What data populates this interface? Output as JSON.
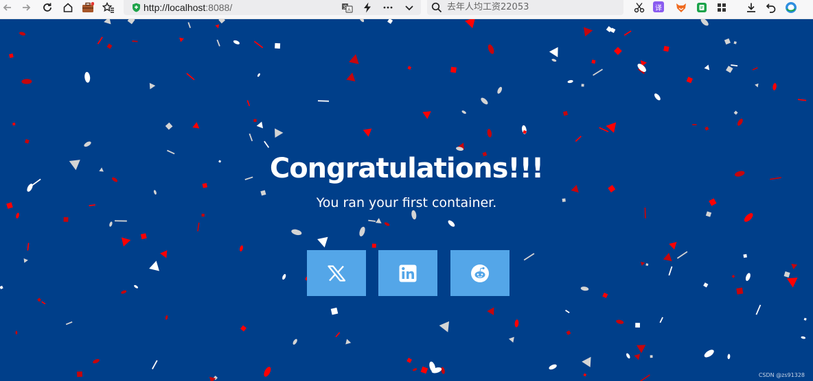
{
  "browser": {
    "url_host": "http://localhost",
    "url_port": ":8088/",
    "search_placeholder": "去年人均工资22053",
    "extensions": [
      {
        "icon": "translate-extension-icon",
        "label": "译",
        "color": "#8a5cf0"
      },
      {
        "icon": "fox-extension-icon",
        "label": "",
        "color": "#ef6b21"
      },
      {
        "icon": "green-extension-icon",
        "label": "",
        "color": "#1aa34a"
      },
      {
        "icon": "apps-grid-icon",
        "label": "",
        "color": "#444444"
      }
    ]
  },
  "page": {
    "headline": "Congratulations!!!",
    "subtitle": "You ran your first container.",
    "background": "#003f8a",
    "button_color": "#54a6e8",
    "share_buttons": [
      {
        "icon": "x-twitter-icon"
      },
      {
        "icon": "linkedin-icon"
      },
      {
        "icon": "reddit-icon"
      }
    ],
    "watermark": "CSDN @zs91328"
  },
  "confetti_colors": [
    "#ff0000",
    "#c4060d",
    "#d4d4d4",
    "#ffffff"
  ]
}
